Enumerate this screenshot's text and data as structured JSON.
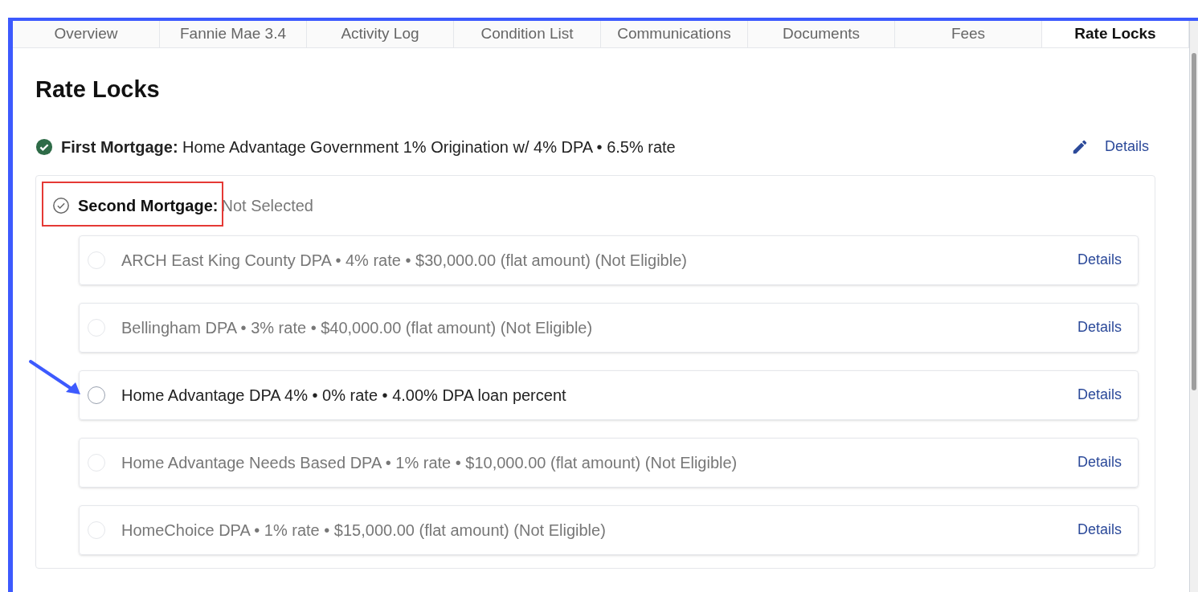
{
  "tabs": [
    {
      "label": "Overview",
      "selected": false
    },
    {
      "label": "Fannie Mae 3.4",
      "selected": false
    },
    {
      "label": "Activity Log",
      "selected": false
    },
    {
      "label": "Condition List",
      "selected": false
    },
    {
      "label": "Communications",
      "selected": false
    },
    {
      "label": "Documents",
      "selected": false
    },
    {
      "label": "Fees",
      "selected": false
    },
    {
      "label": "Rate Locks",
      "selected": true
    }
  ],
  "heading": "Rate Locks",
  "first_mortgage": {
    "label": "First Mortgage:",
    "value": "Home Advantage Government 1% Origination w/ 4% DPA • 6.5% rate",
    "checked": true,
    "details": "Details"
  },
  "second_mortgage": {
    "label": "Second Mortgage:",
    "value": "Not Selected",
    "checked": false,
    "options": [
      {
        "text": "ARCH East King County DPA • 4% rate • $30,000.00 (flat amount) (Not Eligible)",
        "disabled": true,
        "selected": false,
        "details": "Details"
      },
      {
        "text": "Bellingham DPA • 3% rate • $40,000.00 (flat amount) (Not Eligible)",
        "disabled": true,
        "selected": false,
        "details": "Details"
      },
      {
        "text": "Home Advantage DPA 4% • 0% rate • 4.00% DPA loan percent",
        "disabled": false,
        "selected": false,
        "details": "Details"
      },
      {
        "text": "Home Advantage Needs Based DPA • 1% rate • $10,000.00 (flat amount) (Not Eligible)",
        "disabled": true,
        "selected": false,
        "details": "Details"
      },
      {
        "text": "HomeChoice DPA • 1% rate • $15,000.00 (flat amount) (Not Eligible)",
        "disabled": true,
        "selected": false,
        "details": "Details"
      }
    ]
  }
}
